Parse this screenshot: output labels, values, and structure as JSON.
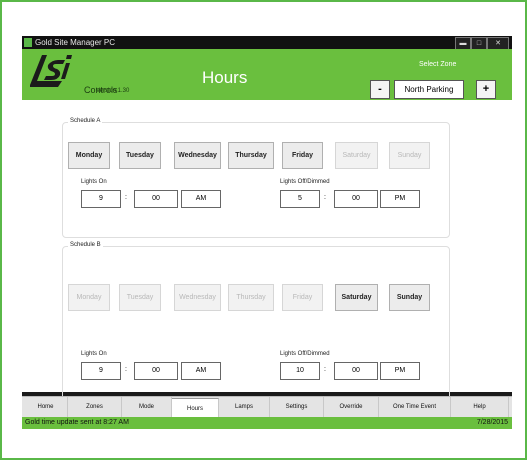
{
  "window": {
    "title": "Gold Site Manager PC"
  },
  "header": {
    "brand": "Controls",
    "version": "Version 1.30",
    "title": "Hours",
    "select_zone_label": "Select Zone",
    "zone_minus": "-",
    "zone_value": "North Parking",
    "zone_plus": "+"
  },
  "schedule_a": {
    "label": "Schedule A",
    "days": [
      {
        "label": "Monday",
        "enabled": true
      },
      {
        "label": "Tuesday",
        "enabled": true
      },
      {
        "label": "Wednesday",
        "enabled": true
      },
      {
        "label": "Thursday",
        "enabled": true
      },
      {
        "label": "Friday",
        "enabled": true
      },
      {
        "label": "Saturday",
        "enabled": false
      },
      {
        "label": "Sunday",
        "enabled": false
      }
    ],
    "lights_on": {
      "label": "Lights On",
      "hour": "9",
      "minute": "00",
      "ampm": "AM"
    },
    "lights_off": {
      "label": "Lights Off/Dimmed",
      "hour": "5",
      "minute": "00",
      "ampm": "PM"
    }
  },
  "schedule_b": {
    "label": "Schedule B",
    "days": [
      {
        "label": "Monday",
        "enabled": false
      },
      {
        "label": "Tuesday",
        "enabled": false
      },
      {
        "label": "Wednesday",
        "enabled": false
      },
      {
        "label": "Thursday",
        "enabled": false
      },
      {
        "label": "Friday",
        "enabled": false
      },
      {
        "label": "Saturday",
        "enabled": true
      },
      {
        "label": "Sunday",
        "enabled": true
      }
    ],
    "lights_on": {
      "label": "Lights On",
      "hour": "9",
      "minute": "00",
      "ampm": "AM"
    },
    "lights_off": {
      "label": "Lights Off/Dimmed",
      "hour": "10",
      "minute": "00",
      "ampm": "PM"
    }
  },
  "colon": ":",
  "tabs": [
    "Home",
    "Zones",
    "Mode",
    "Hours",
    "Lamps",
    "Settings",
    "Override",
    "One Time Event",
    "Help"
  ],
  "active_tab": "Hours",
  "status": {
    "message": "Gold time update sent at 8:27 AM",
    "date": "7/28/2015"
  },
  "colors": {
    "brand_green": "#6abf3e",
    "frame_green": "#5ab848"
  },
  "icons": {
    "app": "app-icon",
    "minimize": "minimize-icon",
    "maximize": "maximize-icon",
    "close": "close-icon",
    "logo": "lsi-logo"
  }
}
